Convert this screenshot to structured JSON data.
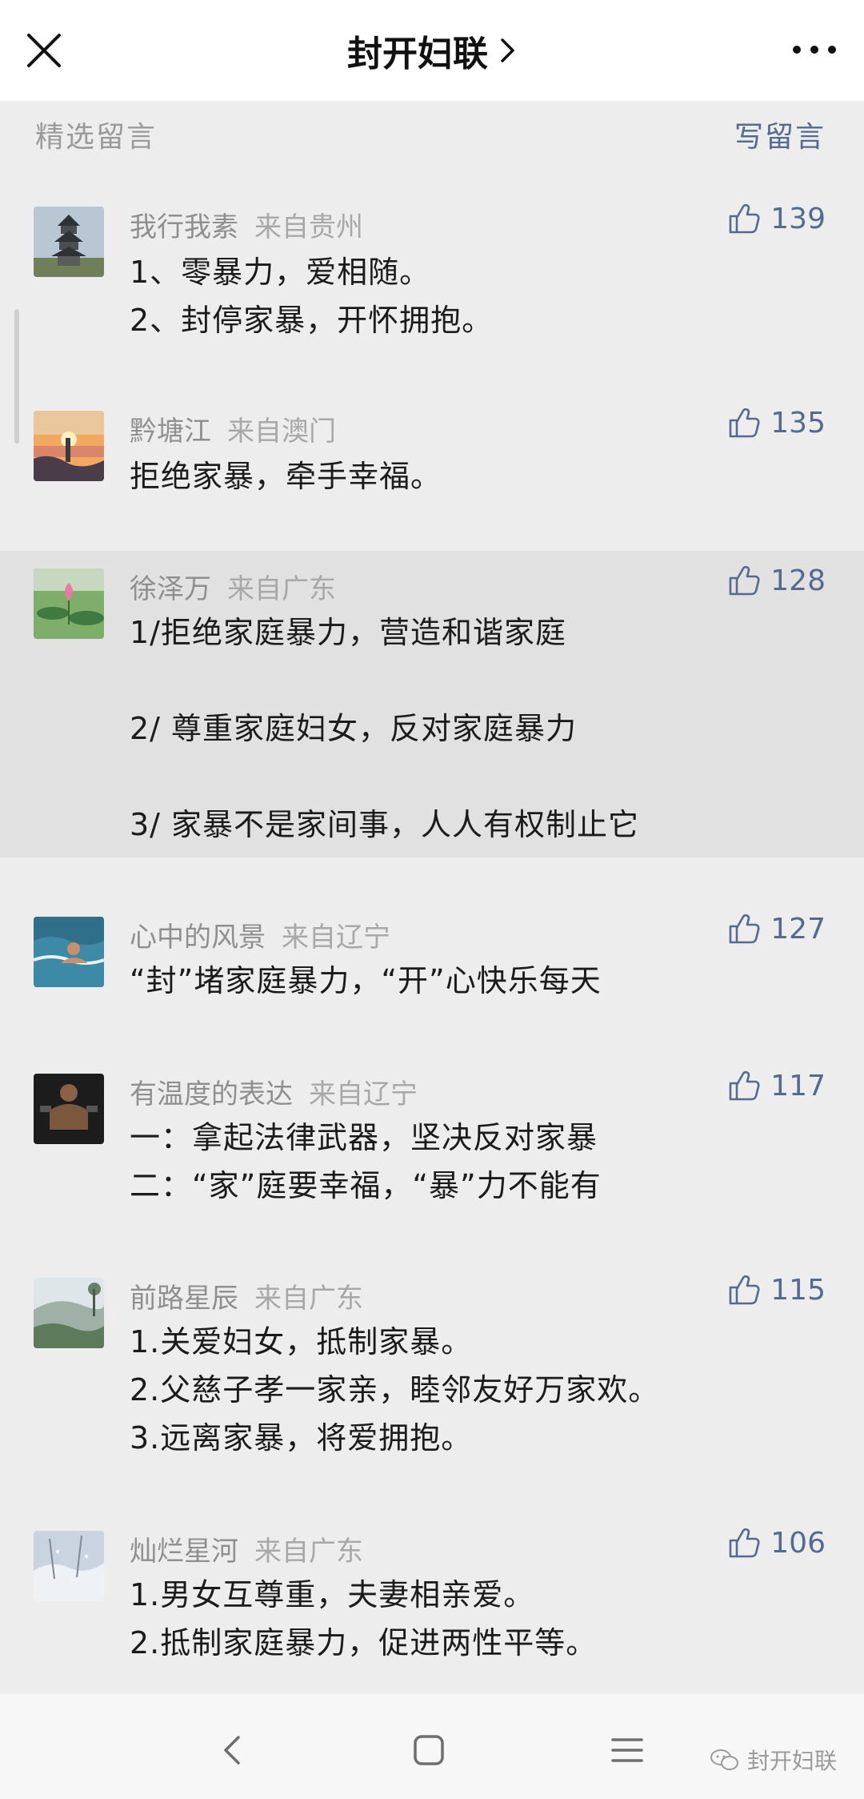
{
  "header": {
    "title": "封开妇联",
    "close_icon": "close-icon",
    "more_icon": "more-icon"
  },
  "section": {
    "label": "精选留言",
    "write_label": "写留言"
  },
  "comments": [
    {
      "name": "我行我素",
      "location": "来自贵州",
      "likes": "139",
      "lines": [
        "1、零暴力，爱相随。",
        "2、封停家暴，开怀拥抱。"
      ],
      "avatar": "pagoda-photo"
    },
    {
      "name": "黔塘江",
      "location": "来自澳门",
      "likes": "135",
      "lines": [
        "拒绝家暴，牵手幸福。"
      ],
      "avatar": "sunset-photo"
    },
    {
      "name": "徐泽万",
      "location": "来自广东",
      "likes": "128",
      "lines": [
        "1/拒绝家庭暴力，营造和谐家庭",
        "",
        "2/ 尊重家庭妇女，反对家庭暴力",
        "",
        "3/ 家暴不是家间事，人人有权制止它"
      ],
      "avatar": "lotus-photo"
    },
    {
      "name": "心中的风景",
      "location": "来自辽宁",
      "likes": "127",
      "lines": [
        "“封”堵家庭暴力，“开”心快乐每天"
      ],
      "avatar": "swimmer-photo"
    },
    {
      "name": "有温度的表达",
      "location": "来自辽宁",
      "likes": "117",
      "lines": [
        "一：拿起法律武器，坚决反对家暴",
        "二：“家”庭要幸福，“暴”力不能有"
      ],
      "avatar": "athlete-photo"
    },
    {
      "name": "前路星辰",
      "location": "来自广东",
      "likes": "115",
      "lines": [
        "1.关爱妇女，抵制家暴。",
        "2.父慈子孝一家亲，睦邻友好万家欢。",
        "3.远离家暴，将爱拥抱。"
      ],
      "avatar": "landscape-photo"
    },
    {
      "name": "灿烂星河",
      "location": "来自广东",
      "likes": "106",
      "lines": [
        "1.男女互尊重，夫妻相亲爱。",
        "2.抵制家庭暴力，促进两性平等。"
      ],
      "avatar": "snow-photo"
    }
  ],
  "navbar": {
    "back_icon": "back-icon",
    "home_icon": "home-icon",
    "menu_icon": "menu-icon",
    "watermark": "封开妇联"
  },
  "colors": {
    "accent": "#536b8e",
    "background": "#ededed",
    "highlight": "#e1e1e1"
  }
}
